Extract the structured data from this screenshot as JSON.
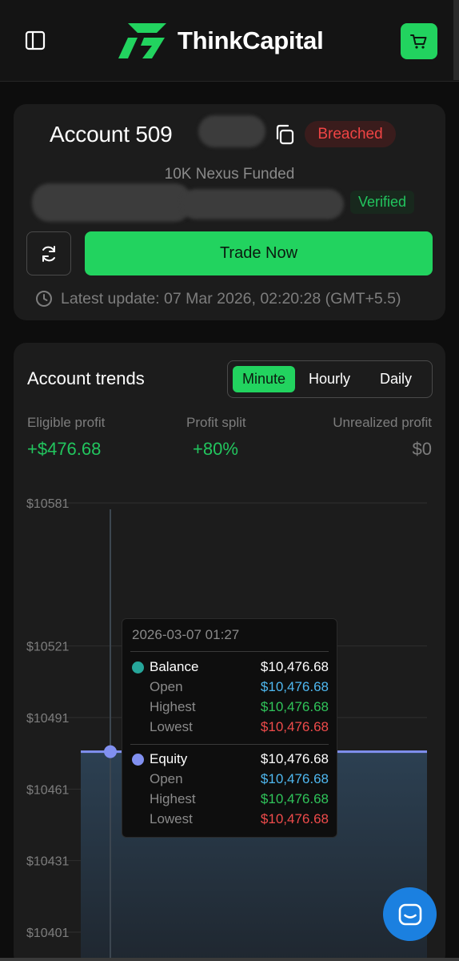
{
  "header": {
    "brand": "ThinkCapital",
    "menu_icon": "sidebar-toggle-icon",
    "cart_icon": "cart-icon",
    "accent": "#22d35f"
  },
  "account": {
    "title": "Account 509",
    "status": "Breached",
    "plan": "10K Nexus Funded",
    "verified": "Verified",
    "trade_label": "Trade Now",
    "latest_update": "Latest update: 07 Mar 2026, 02:20:28 (GMT+5.5)"
  },
  "trends": {
    "title": "Account trends",
    "tabs": [
      {
        "label": "Minute",
        "active": true
      },
      {
        "label": "Hourly",
        "active": false
      },
      {
        "label": "Daily",
        "active": false
      }
    ],
    "stats": [
      {
        "label": "Eligible profit",
        "value": "+$476.68"
      },
      {
        "label": "Profit split",
        "value": "+80%"
      },
      {
        "label": "Unrealized profit",
        "value": "$0"
      }
    ]
  },
  "chart_data": {
    "type": "area",
    "y_ticks": [
      "$10581",
      "$10521",
      "$10491",
      "$10461",
      "$10431",
      "$10401"
    ],
    "y_tick_values": [
      10581,
      10521,
      10491,
      10461,
      10431,
      10401
    ],
    "series": [
      {
        "name": "Balance",
        "values": [
          10476.68,
          10476.68
        ],
        "color": "#26a69a"
      },
      {
        "name": "Equity",
        "values": [
          10476.68,
          10476.68
        ],
        "color": "#8190f0"
      }
    ],
    "grid": true
  },
  "tooltip": {
    "date": "2026-03-07 01:27",
    "groups": [
      {
        "name": "Balance",
        "value": "$10,476.68",
        "rows": [
          {
            "label": "Open",
            "value": "$10,476.68"
          },
          {
            "label": "Highest",
            "value": "$10,476.68"
          },
          {
            "label": "Lowest",
            "value": "$10,476.68"
          }
        ]
      },
      {
        "name": "Equity",
        "value": "$10,476.68",
        "rows": [
          {
            "label": "Open",
            "value": "$10,476.68"
          },
          {
            "label": "Highest",
            "value": "$10,476.68"
          },
          {
            "label": "Lowest",
            "value": "$10,476.68"
          }
        ]
      }
    ]
  },
  "chat": {
    "icon": "chat-icon",
    "color": "#1b80e0"
  }
}
